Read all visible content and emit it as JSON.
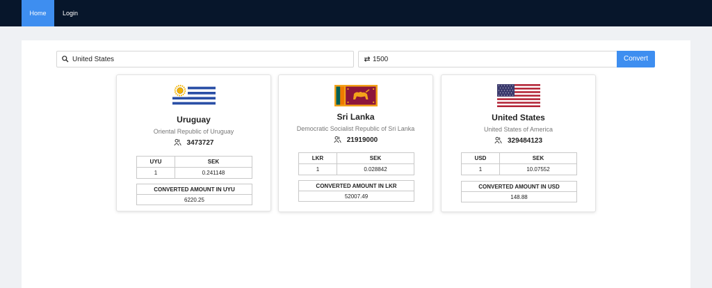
{
  "nav": {
    "home": "Home",
    "login": "Login"
  },
  "search": {
    "value": "United States",
    "icon": "search-icon"
  },
  "amount": {
    "value": "1500",
    "icon": "swap-icon"
  },
  "convert_button": "Convert",
  "colors": {
    "nav_bg": "#07162b",
    "accent": "#3e8ef0",
    "panel_bg": "#ffffff",
    "page_bg": "#eff1f4"
  },
  "cards": [
    {
      "name": "Uruguay",
      "official": "Oriental Republic of Uruguay",
      "population": "3473727",
      "rate_header": [
        "UYU",
        "SEK"
      ],
      "rate_row": [
        "1",
        "0.241148"
      ],
      "converted_label": "CONVERTED AMOUNT IN UYU",
      "converted_value": "6220.25"
    },
    {
      "name": "Sri Lanka",
      "official": "Democratic Socialist Republic of Sri Lanka",
      "population": "21919000",
      "rate_header": [
        "LKR",
        "SEK"
      ],
      "rate_row": [
        "1",
        "0.028842"
      ],
      "converted_label": "CONVERTED AMOUNT IN LKR",
      "converted_value": "52007.49"
    },
    {
      "name": "United States",
      "official": "United States of America",
      "population": "329484123",
      "rate_header": [
        "USD",
        "SEK"
      ],
      "rate_row": [
        "1",
        "10.07552"
      ],
      "converted_label": "CONVERTED AMOUNT IN USD",
      "converted_value": "148.88"
    }
  ]
}
